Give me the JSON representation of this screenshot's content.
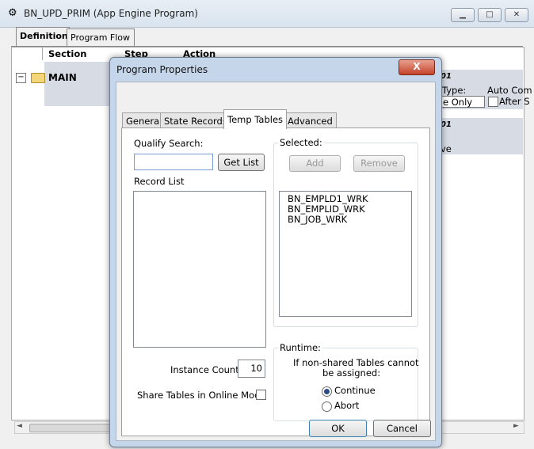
{
  "main_window": {
    "title": "BN_UPD_PRIM (App Engine Program)",
    "tabs": [
      "Definition",
      "Program Flow"
    ],
    "columns": [
      "Section",
      "Step",
      "Action"
    ],
    "tree_item": "MAIN",
    "partial_right": {
      "r1": "01",
      "type_label": "Type:",
      "auto_commit": "Auto Com",
      "only": "e Only",
      "after": "After S",
      "r2": "01",
      "ve": "ve"
    }
  },
  "dialog": {
    "title": "Program Properties",
    "close_glyph": "X",
    "tabs": [
      "General",
      "State Records",
      "Temp Tables",
      "Advanced"
    ],
    "qualify_search_label": "Qualify Search:",
    "qualify_search_value": "",
    "get_list_label": "Get List",
    "record_list_label": "Record List",
    "selected_label": "Selected:",
    "add_label": "Add",
    "remove_label": "Remove",
    "selected_items": [
      "BN_EMPLD1_WRK",
      "BN_EMPLID_WRK",
      "BN_JOB_WRK"
    ],
    "instance_count_label": "Instance Count:",
    "instance_count_value": "10",
    "share_tables_label": "Share Tables in Online Mode",
    "runtime_label": "Runtime:",
    "runtime_note_line1": "If non-shared Tables cannot",
    "runtime_note_line2": "be assigned:",
    "runtime_options": [
      "Continue",
      "Abort"
    ],
    "ok_label": "OK",
    "cancel_label": "Cancel"
  }
}
